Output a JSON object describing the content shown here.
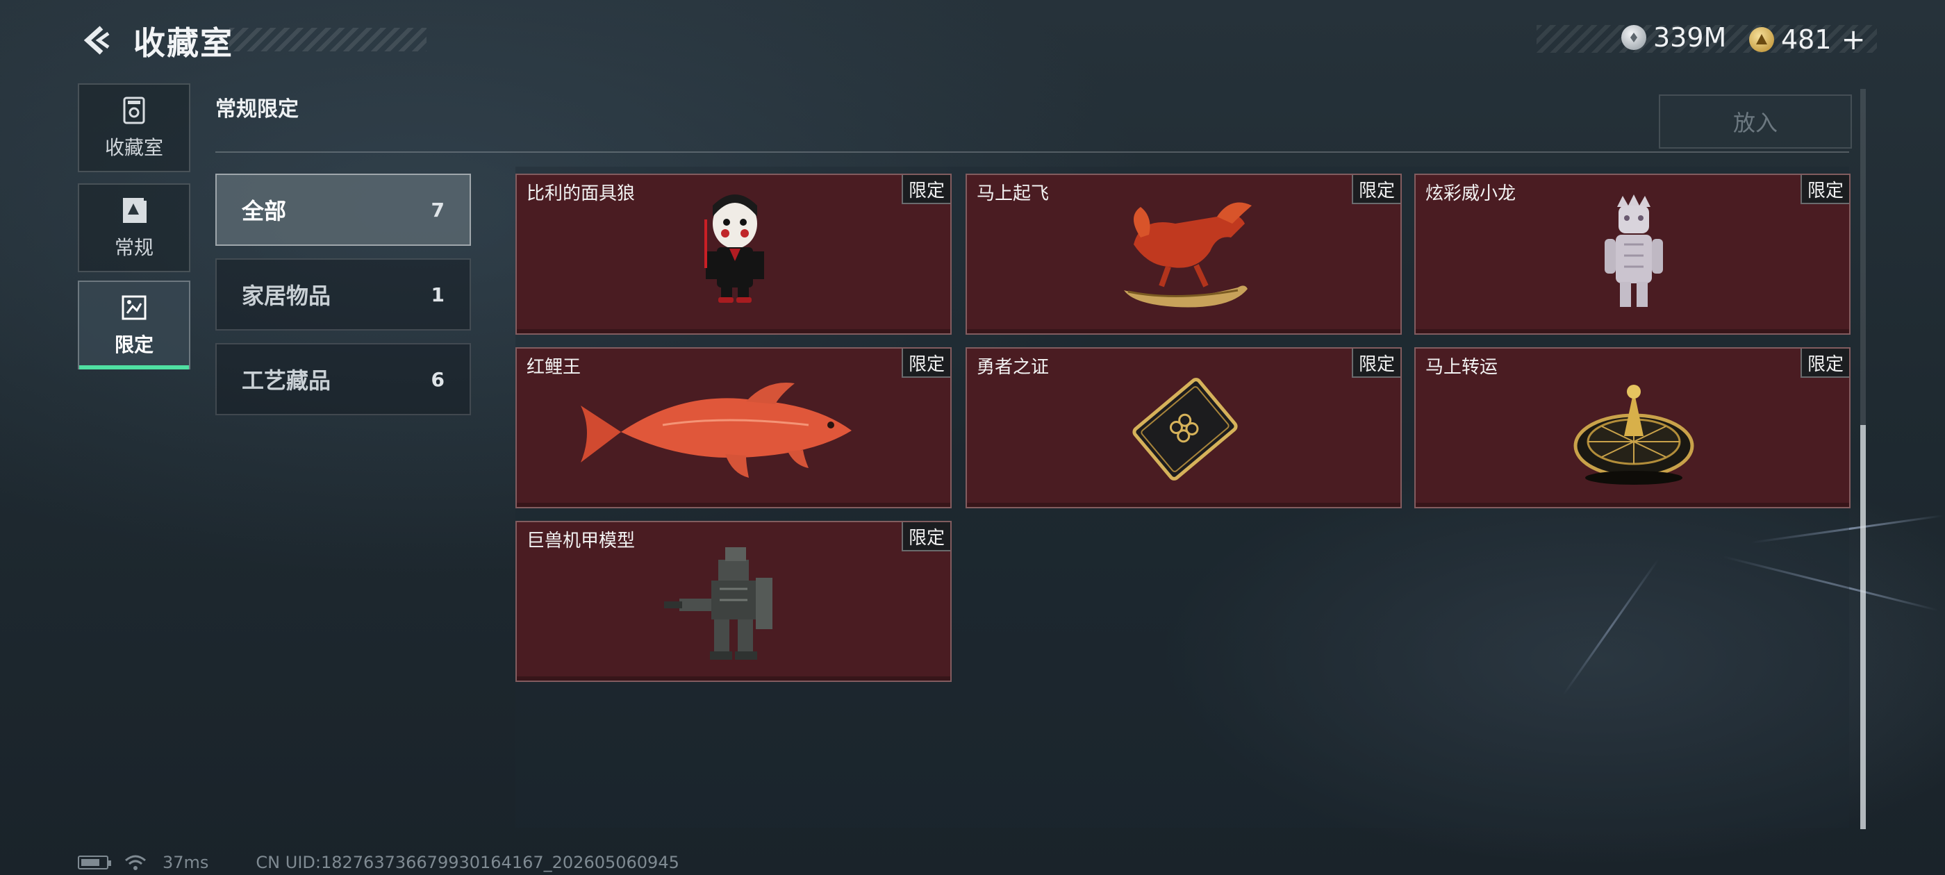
{
  "header": {
    "title": "收藏室",
    "back_icon": "back-arrow-icon",
    "currencies": [
      {
        "icon": "silver-coin-icon",
        "value": "339M"
      },
      {
        "icon": "gold-triangle-coin-icon",
        "value": "481"
      }
    ],
    "add_currency_icon": "plus-icon"
  },
  "sidebar": {
    "items": [
      {
        "label": "收藏室",
        "icon": "collection-room-icon",
        "active": false
      },
      {
        "label": "常规",
        "icon": "regular-icon",
        "active": false
      },
      {
        "label": "限定",
        "icon": "limited-icon",
        "active": true
      }
    ],
    "accent_color": "#4fe0a2"
  },
  "section": {
    "title": "常规限定",
    "put_button_label": "放入"
  },
  "categories": [
    {
      "name": "全部",
      "count": "7",
      "active": true
    },
    {
      "name": "家居物品",
      "count": "1",
      "active": false
    },
    {
      "name": "工艺藏品",
      "count": "6",
      "active": false
    }
  ],
  "items": [
    {
      "name": "比利的面具狼",
      "badge": "限定",
      "icon": "billy-puppet-figure-icon"
    },
    {
      "name": "马上起飞",
      "badge": "限定",
      "icon": "red-horse-statue-icon"
    },
    {
      "name": "炫彩威小龙",
      "badge": "限定",
      "icon": "silver-dragon-figure-icon"
    },
    {
      "name": "红鲤王",
      "badge": "限定",
      "icon": "red-carp-icon"
    },
    {
      "name": "勇者之证",
      "badge": "限定",
      "icon": "black-gold-card-icon"
    },
    {
      "name": "马上转运",
      "badge": "限定",
      "icon": "golden-roulette-icon"
    },
    {
      "name": "巨兽机甲模型",
      "badge": "限定",
      "icon": "mecha-model-icon"
    }
  ],
  "card_color": "#4a1c22",
  "footer": {
    "battery_icon": "battery-icon",
    "wifi_icon": "wifi-icon",
    "ping": "37ms",
    "uid": "CN UID:182763736679930164167_202605060945"
  }
}
